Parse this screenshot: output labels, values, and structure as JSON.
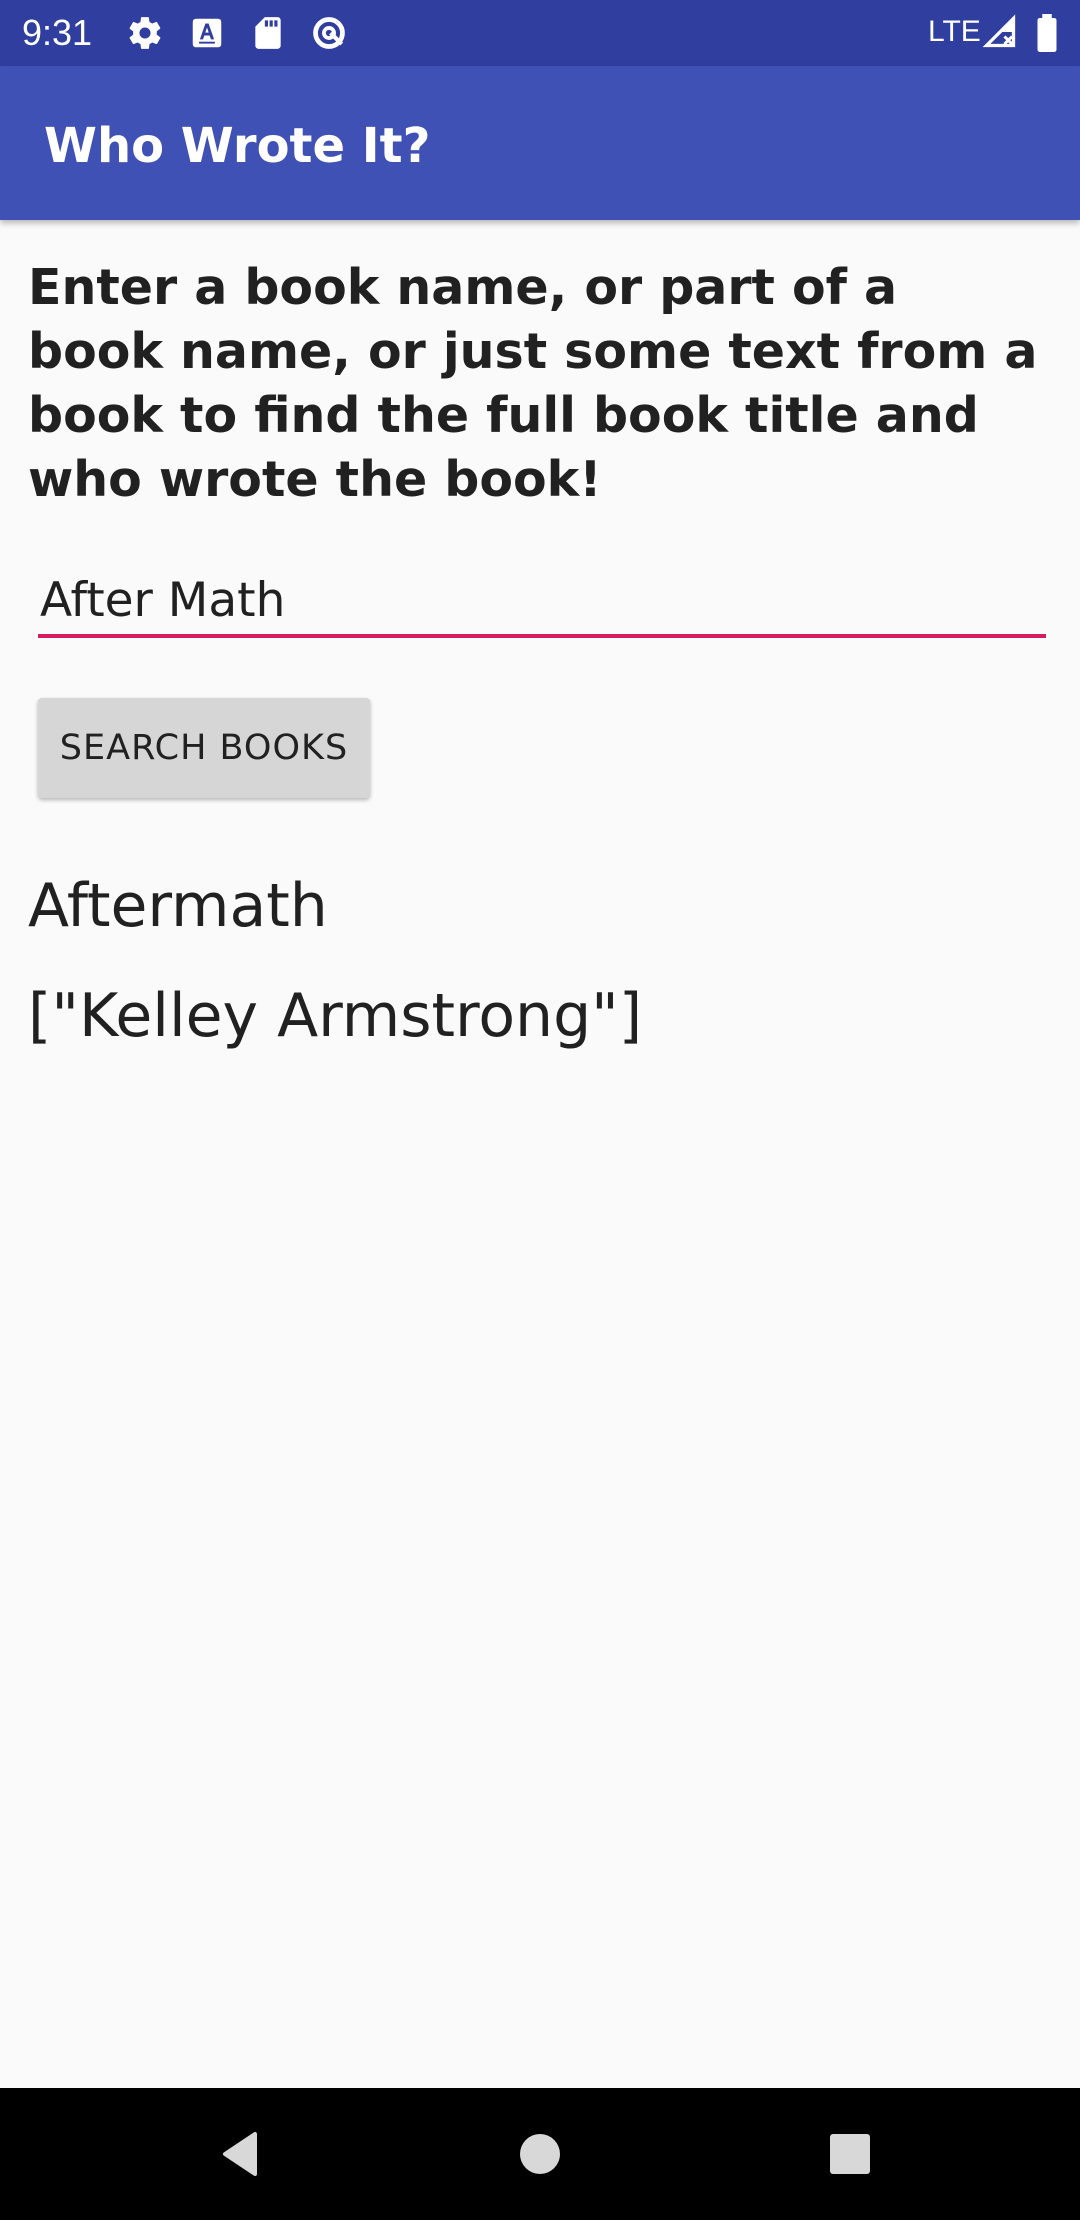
{
  "status_bar": {
    "time": "9:31",
    "network": "LTE",
    "background_color": "#303f9f",
    "icons": [
      "settings-icon",
      "text-a-icon",
      "sd-card-icon",
      "data-saver-icon",
      "signal-icon",
      "battery-icon"
    ]
  },
  "app_bar": {
    "title": "Who Wrote It?",
    "background_color": "#3f51b5"
  },
  "main": {
    "instructions": "Enter a book name, or part of a book name, or just some text from a book to find the full book title and who wrote the book!",
    "search_input": {
      "value": "After Math",
      "placeholder": "",
      "underline_color": "#d81b60"
    },
    "search_button_label": "SEARCH BOOKS",
    "result": {
      "title": "Aftermath",
      "author": "[\"Kelley Armstrong\"]"
    }
  },
  "nav_bar": {
    "buttons": [
      "back-icon",
      "home-icon",
      "recents-icon"
    ]
  }
}
